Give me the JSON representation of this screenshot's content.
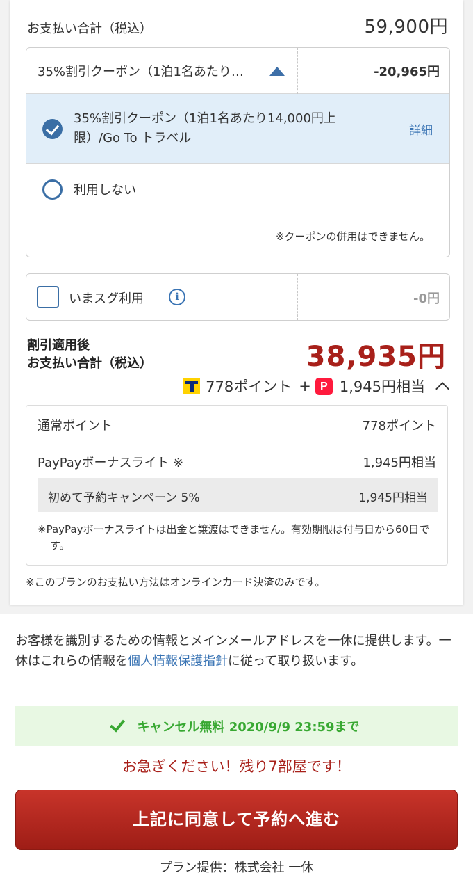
{
  "summary": {
    "total_label": "お支払い合計（税込）",
    "total_amount": "59,900円"
  },
  "coupon": {
    "selected_label": "35%割引クーポン（1泊1名あたり…",
    "discount": "-20,965円",
    "options": [
      {
        "label": "35%割引クーポン（1泊1名あたり14,000円上限）/Go To トラベル",
        "detail_link": "詳細",
        "selected": true
      },
      {
        "label": "利用しない",
        "selected": false
      }
    ],
    "note": "※クーポンの併用はできません。"
  },
  "points_use": {
    "label": "いまスグ利用",
    "icon": "info-icon",
    "value": "-0円",
    "checked": false
  },
  "after_discount": {
    "label_line1": "割引適用後",
    "label_line2": "お支払い合計（税込）",
    "amount": "38,935円",
    "earn_points": "778ポイント",
    "earn_plus": "+",
    "earn_paypay": "1,945円相当",
    "paypay_icon_text": "P"
  },
  "breakdown": {
    "row1_label": "通常ポイント",
    "row1_value": "778ポイント",
    "row2_label": "PayPayボーナスライト ※",
    "row2_value": "1,945円相当",
    "sub_label": "初めて予約キャンペーン 5%",
    "sub_value": "1,945円相当",
    "note": "※PayPayボーナスライトは出金と譲渡はできません。有効期限は付与日から60日です。"
  },
  "payment_note": "※このプランのお支払い方法はオンラインカード決済のみです。",
  "privacy": {
    "text_before": "お客様を識別するための情報とメインメールアドレスを一休に提供します。一休はこれらの情報を",
    "link": "個人情報保護指針",
    "text_after": "に従って取り扱います。"
  },
  "cancel_free": "キャンセル無料 2020/9/9 23:59まで",
  "urgent": "お急ぎください！残り7部屋です！",
  "reserve_button": "上記に同意して予約へ進む",
  "provider": "プラン提供：株式会社 一休",
  "colors": {
    "accent_red": "#a8201a",
    "link_blue": "#3a74b4",
    "check_blue": "#3a6ea5",
    "selected_bg": "#e1eef9",
    "green": "#38a832",
    "green_bg": "#e8f8e3"
  }
}
